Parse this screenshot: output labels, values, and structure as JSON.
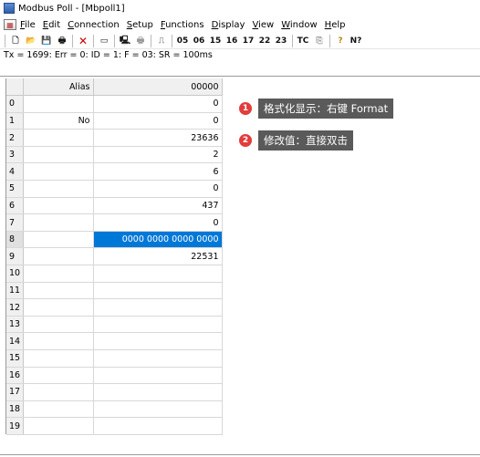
{
  "window": {
    "title": "Modbus Poll - [Mbpoll1]",
    "icon": "modbus-app-icon"
  },
  "menu": {
    "items": [
      {
        "mn": "F",
        "rest": "ile"
      },
      {
        "mn": "E",
        "rest": "dit"
      },
      {
        "mn": "C",
        "rest": "onnection"
      },
      {
        "mn": "S",
        "rest": "etup"
      },
      {
        "mn": "F",
        "rest": "unctions"
      },
      {
        "mn": "D",
        "rest": "isplay"
      },
      {
        "mn": "V",
        "rest": "iew"
      },
      {
        "mn": "W",
        "rest": "indow"
      },
      {
        "mn": "H",
        "rest": "elp"
      }
    ]
  },
  "toolbar": {
    "function_codes": [
      "05",
      "06",
      "15",
      "16",
      "17",
      "22",
      "23"
    ],
    "tc_label": "TC",
    "help_glyph": "?",
    "context_help_glyph": "N?"
  },
  "status": {
    "text": "Tx = 1699: Err = 0: ID = 1: F = 03: SR = 100ms"
  },
  "grid": {
    "header": {
      "alias": "Alias",
      "value": "00000"
    },
    "rows": [
      {
        "num": "0",
        "alias": "",
        "value": "0"
      },
      {
        "num": "1",
        "alias": "No",
        "value": "0"
      },
      {
        "num": "2",
        "alias": "",
        "value": "23636"
      },
      {
        "num": "3",
        "alias": "",
        "value": "2"
      },
      {
        "num": "4",
        "alias": "",
        "value": "6"
      },
      {
        "num": "5",
        "alias": "",
        "value": "0"
      },
      {
        "num": "6",
        "alias": "",
        "value": "437"
      },
      {
        "num": "7",
        "alias": "",
        "value": "0"
      },
      {
        "num": "8",
        "alias": "",
        "value": "0000 0000 0000 0000"
      },
      {
        "num": "9",
        "alias": "",
        "value": "22531"
      },
      {
        "num": "10",
        "alias": "",
        "value": ""
      },
      {
        "num": "11",
        "alias": "",
        "value": ""
      },
      {
        "num": "12",
        "alias": "",
        "value": ""
      },
      {
        "num": "13",
        "alias": "",
        "value": ""
      },
      {
        "num": "14",
        "alias": "",
        "value": ""
      },
      {
        "num": "15",
        "alias": "",
        "value": ""
      },
      {
        "num": "16",
        "alias": "",
        "value": ""
      },
      {
        "num": "17",
        "alias": "",
        "value": ""
      },
      {
        "num": "18",
        "alias": "",
        "value": ""
      },
      {
        "num": "19",
        "alias": "",
        "value": ""
      }
    ],
    "selected_row": 8,
    "selection_color": "#0078d7"
  },
  "callouts": [
    {
      "badge": "1",
      "text": "格式化显示：右键 Format"
    },
    {
      "badge": "2",
      "text": "修改值：直接双击"
    }
  ],
  "colors": {
    "badge": "#e23c3c",
    "bubble": "#5a5a5a"
  }
}
